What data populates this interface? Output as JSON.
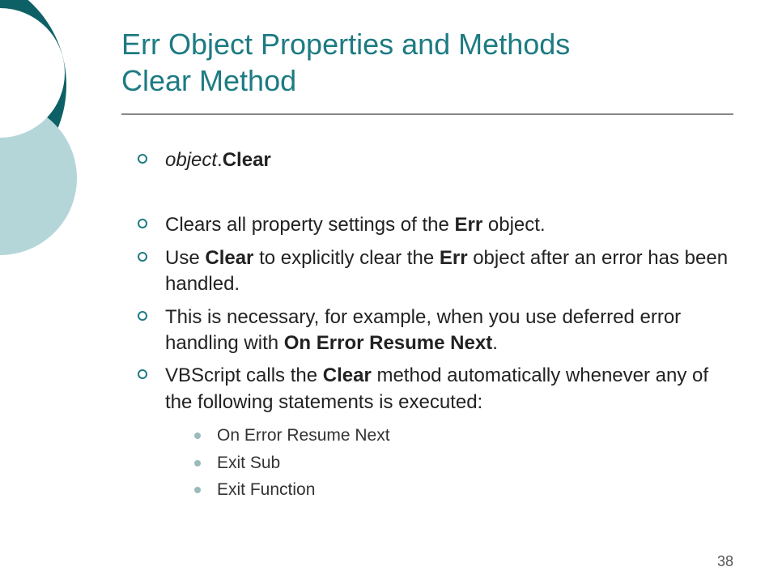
{
  "title_line1": "Err Object Properties and Methods",
  "title_line2": "Clear Method",
  "bullets": [
    {
      "segments": [
        {
          "text": "object",
          "style": "italic"
        },
        {
          "text": ".",
          "style": ""
        },
        {
          "text": "Clear",
          "style": "bold"
        }
      ],
      "spacer": true
    },
    {
      "segments": [
        {
          "text": "Clears all property settings of the ",
          "style": ""
        },
        {
          "text": "Err",
          "style": "bold"
        },
        {
          "text": " object.",
          "style": ""
        }
      ]
    },
    {
      "segments": [
        {
          "text": "Use ",
          "style": ""
        },
        {
          "text": "Clear",
          "style": "bold"
        },
        {
          "text": " to explicitly clear the ",
          "style": ""
        },
        {
          "text": "Err",
          "style": "bold"
        },
        {
          "text": " object after an error has been handled.",
          "style": ""
        }
      ]
    },
    {
      "segments": [
        {
          "text": "This is necessary, for example, when you use deferred error handling with ",
          "style": ""
        },
        {
          "text": "On Error Resume Next",
          "style": "bold"
        },
        {
          "text": ".",
          "style": ""
        }
      ]
    },
    {
      "segments": [
        {
          "text": "VBScript calls the ",
          "style": ""
        },
        {
          "text": "Clear",
          "style": "bold"
        },
        {
          "text": " method automatically whenever any of the following statements is executed:",
          "style": ""
        }
      ],
      "subitems": [
        "On Error Resume Next",
        "Exit Sub",
        "Exit Function"
      ]
    }
  ],
  "page_number": "38"
}
